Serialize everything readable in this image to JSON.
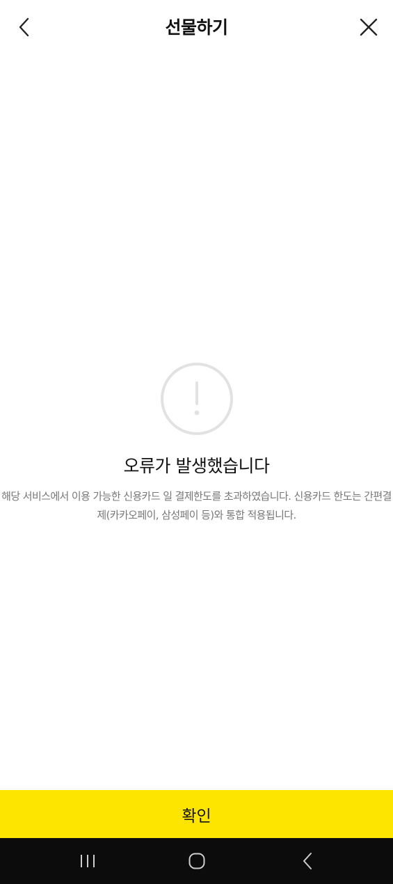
{
  "header": {
    "title": "선물하기",
    "back_icon": "chevron-left-icon",
    "close_icon": "close-icon"
  },
  "error": {
    "icon": "exclamation-circle-icon",
    "title": "오류가 발생했습니다",
    "description": "해당 서비스에서 이용 가능한 신용카드 일 결제한도를 초과하였습니다. 신용카드 한도는 간편결제(카카오페이, 삼성페이 등)와 통합 적용됩니다."
  },
  "confirm_button": {
    "label": "확인",
    "color": "#fee500"
  },
  "system_nav": {
    "recents_icon": "recents-icon",
    "home_icon": "home-icon",
    "back_icon": "back-icon"
  }
}
